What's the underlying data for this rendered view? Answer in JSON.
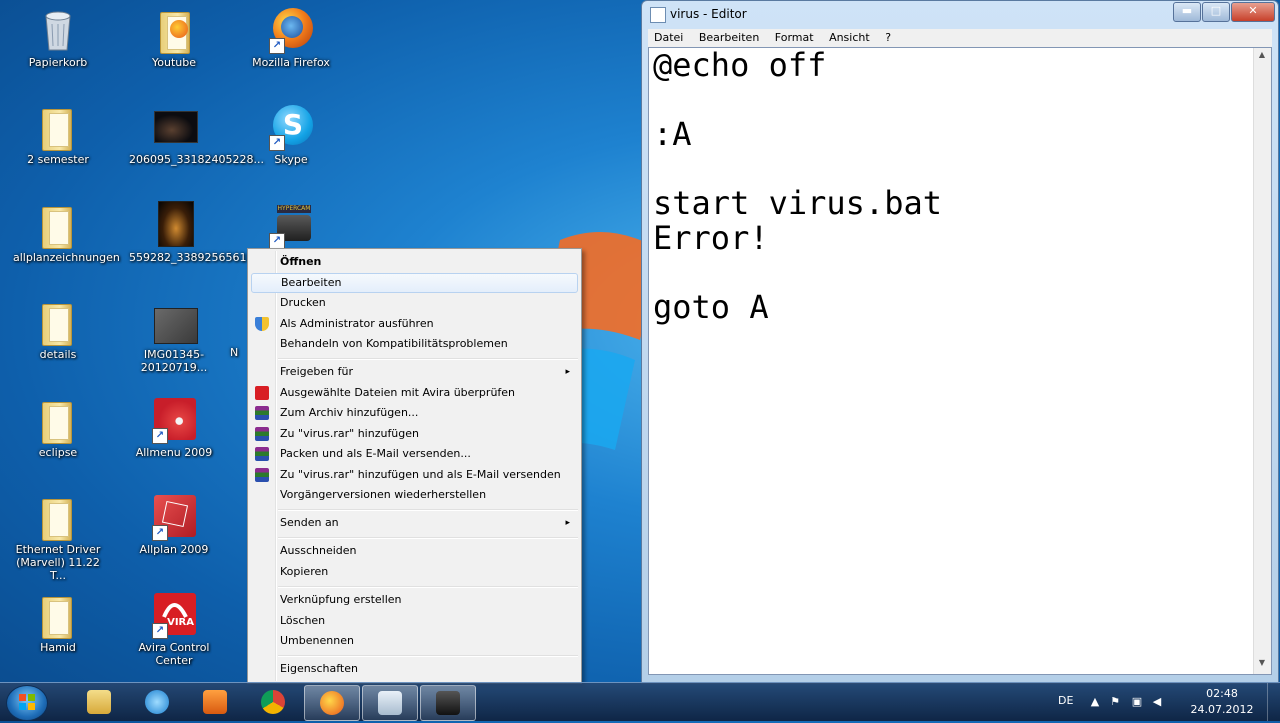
{
  "desktop_icons": [
    {
      "label": "Papierkorb",
      "icon": "recycle-bin-icon"
    },
    {
      "label": "Youtube",
      "icon": "firefox-document-icon"
    },
    {
      "label": "Mozilla Firefox",
      "icon": "firefox-icon"
    },
    {
      "label": "2 semester",
      "icon": "folder-icon"
    },
    {
      "label": "206095_33182405228...",
      "icon": "image-thumbnail-icon"
    },
    {
      "label": "Skype",
      "icon": "skype-icon"
    },
    {
      "label": "allplanzeichnungen",
      "icon": "folder-icon"
    },
    {
      "label": "559282_33892565618...",
      "icon": "image-thumbnail-icon"
    },
    {
      "label": "details",
      "icon": "folder-icon"
    },
    {
      "label": "IMG01345-20120719...",
      "icon": "image-thumbnail-icon"
    },
    {
      "label": "eclipse",
      "icon": "folder-icon"
    },
    {
      "label": "Allmenu 2009",
      "icon": "allmenu-icon"
    },
    {
      "label": "Ethernet Driver (Marvell) 11.22 T...",
      "icon": "folder-icon"
    },
    {
      "label": "Allplan 2009",
      "icon": "allplan-icon"
    },
    {
      "label": "Hamid",
      "icon": "folder-icon"
    },
    {
      "label": "Avira Control Center",
      "icon": "avira-icon"
    },
    {
      "label": "N",
      "icon": "partial-label"
    }
  ],
  "context_menu": {
    "items": [
      {
        "label": "Öffnen"
      },
      {
        "label": "Bearbeiten"
      },
      {
        "label": "Drucken"
      },
      {
        "label": "Als Administrator ausführen"
      },
      {
        "label": "Behandeln von Kompatibilitätsproblemen"
      },
      {
        "label": "Freigeben für"
      },
      {
        "label": "Ausgewählte Dateien mit Avira überprüfen"
      },
      {
        "label": "Zum Archiv hinzufügen..."
      },
      {
        "label": "Zu \"virus.rar\" hinzufügen"
      },
      {
        "label": "Packen und als E-Mail versenden..."
      },
      {
        "label": "Zu \"virus.rar\" hinzufügen und als E-Mail versenden"
      },
      {
        "label": "Vorgängerversionen wiederherstellen"
      },
      {
        "label": "Senden an"
      },
      {
        "label": "Ausschneiden"
      },
      {
        "label": "Kopieren"
      },
      {
        "label": "Verknüpfung erstellen"
      },
      {
        "label": "Löschen"
      },
      {
        "label": "Umbenennen"
      },
      {
        "label": "Eigenschaften"
      }
    ],
    "submenu_arrow": "▸"
  },
  "notepad": {
    "title": "virus - Editor",
    "menu": [
      "Datei",
      "Bearbeiten",
      "Format",
      "Ansicht",
      "?"
    ],
    "content": "@echo off\n\n:A\n\nstart virus.bat\nError!\n\ngoto A",
    "buttons": {
      "minimize": "▬",
      "maximize": "□",
      "close": "✕"
    }
  },
  "taskbar": {
    "language": "DE",
    "time": "02:48",
    "date": "24.07.2012",
    "apps": [
      "windows-explorer-icon",
      "internet-explorer-icon",
      "media-player-icon",
      "chrome-icon",
      "firefox-icon",
      "notepad-icon",
      "hypercam-icon"
    ]
  },
  "colors": {
    "desktop": "#1e82d0",
    "taskbar": "#1c3556",
    "menu_bg": "#f1f1f1",
    "menu_hover": "#e4eefb",
    "notepad_frame": "#b4cfe8"
  }
}
